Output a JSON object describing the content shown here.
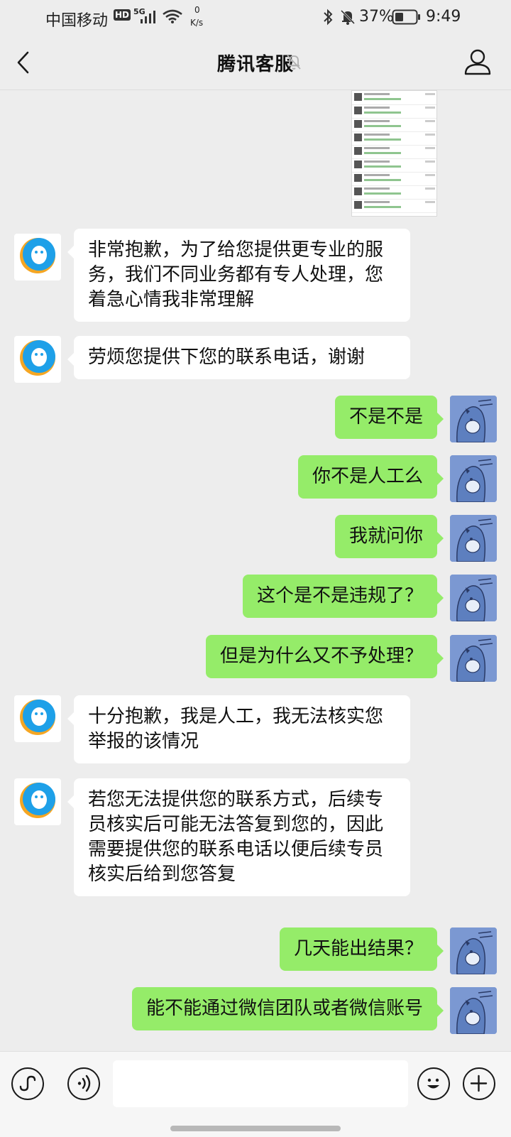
{
  "status_bar": {
    "carrier": "中国移动",
    "hd": "HD",
    "network": "5G",
    "speed_value": "0",
    "speed_unit": "K/s",
    "battery": "37%",
    "time": "9:49"
  },
  "header": {
    "title": "腾讯客服",
    "back_icon": "chevron-left-icon",
    "mute_icon": "bell-off-icon",
    "profile_icon": "person-icon"
  },
  "messages": [
    {
      "side": "left",
      "text": "非常抱歉，为了给您提供更专业的服务，我们不同业务都有专人处理，您着急心情我非常理解"
    },
    {
      "side": "left",
      "text": "劳烦您提供下您的联系电话，谢谢"
    },
    {
      "side": "right",
      "text": "不是不是"
    },
    {
      "side": "right",
      "text": "你不是人工么"
    },
    {
      "side": "right",
      "text": "我就问你"
    },
    {
      "side": "right",
      "text": "这个是不是违规了？"
    },
    {
      "side": "right",
      "text": "但是为什么又不予处理？"
    },
    {
      "side": "left",
      "text": "十分抱歉，我是人工，我无法核实您举报的该情况"
    },
    {
      "side": "left",
      "text": "若您无法提供您的联系方式，后续专员核实后可能无法答复到您的，因此需要提供您的联系电话以便后续专员核实后给到您答复"
    },
    {
      "side": "right",
      "text": "几天能出结果？"
    },
    {
      "side": "right",
      "text": "能不能通过微信团队或者微信账号"
    }
  ],
  "input_bar": {
    "link_icon": "mini-program-icon",
    "voice_icon": "voice-icon",
    "input_value": "",
    "emoji_icon": "emoji-icon",
    "plus_icon": "plus-icon"
  },
  "colors": {
    "background": "#ededed",
    "bubble_self": "#95ec69",
    "bubble_other": "#ffffff",
    "qq_blue": "#1ea0e8",
    "qq_orange": "#f5a623"
  }
}
